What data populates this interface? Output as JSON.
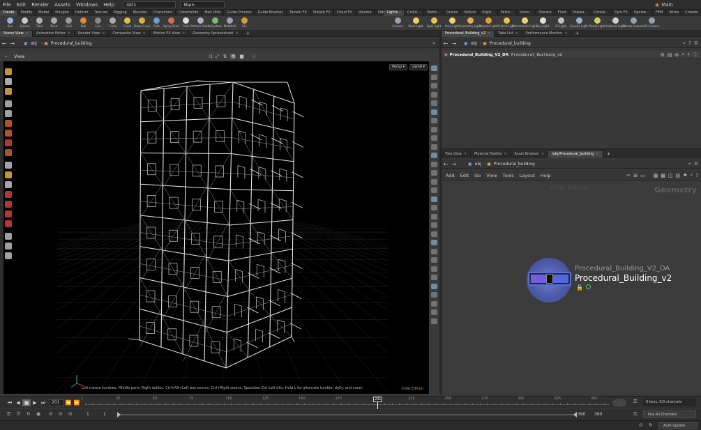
{
  "menubar": {
    "items": [
      "File",
      "Edit",
      "Render",
      "Assets",
      "Windows",
      "Help"
    ],
    "desktop": "GD1",
    "context": "Main",
    "right_label": "Main"
  },
  "shelf_left_tabs": [
    "Create",
    "Modify",
    "Model",
    "Polygon",
    "Deform",
    "Texture",
    "Rigging",
    "Muscles",
    "Characters",
    "Constraints",
    "Hair Utils",
    "Guide Process",
    "Guide Brushes",
    "Terrain FX",
    "Simple FX",
    "Cloud FX",
    "Volume",
    "SideFX Labs"
  ],
  "shelf_right_tabs": [
    "Lights...",
    "Collisi...",
    "Partic...",
    "Grains",
    "Vellum",
    "Rigid...",
    "Partic...",
    "Visco...",
    "Oceans",
    "Fluid",
    "Popula...",
    "Contai...",
    "Pyro FX",
    "Sparse...",
    "FEM",
    "Wires",
    "Crowds",
    "Drive..."
  ],
  "shelf_left_tools": [
    {
      "label": "Box",
      "color": "#8fb3d9"
    },
    {
      "label": "Sphere",
      "color": "#c9c9c9"
    },
    {
      "label": "Tube",
      "color": "#b0b0b0"
    },
    {
      "label": "Torus",
      "color": "#a8a8a8"
    },
    {
      "label": "Grid",
      "color": "#9a9a9a"
    },
    {
      "label": "Null",
      "color": "#e08a2c"
    },
    {
      "label": "Line",
      "color": "#888888"
    },
    {
      "label": "Circle",
      "color": "#aaaaaa"
    },
    {
      "label": "Curve",
      "color": "#e0c040"
    },
    {
      "label": "Draw Curve",
      "color": "#d6b040"
    },
    {
      "label": "Path",
      "color": "#70a0d0"
    },
    {
      "label": "Spray Paint",
      "color": "#d07050"
    },
    {
      "label": "Font",
      "color": "#dddddd"
    },
    {
      "label": "Platonic Solids",
      "color": "#b0b0c0"
    },
    {
      "label": "L-System",
      "color": "#7cb870"
    },
    {
      "label": "Metaball",
      "color": "#a0a0b0"
    },
    {
      "label": "File",
      "color": "#d0a040"
    }
  ],
  "shelf_right_tools": [
    {
      "label": "Camera",
      "color": "#9aa0a8"
    },
    {
      "label": "Point Light",
      "color": "#f0d060"
    },
    {
      "label": "Spot Light",
      "color": "#f0c050"
    },
    {
      "label": "Area Light",
      "color": "#f0d070"
    },
    {
      "label": "Geometry Light",
      "color": "#e0b050"
    },
    {
      "label": "Volume Light",
      "color": "#e09a40"
    },
    {
      "label": "Distant Light",
      "color": "#f0c040"
    },
    {
      "label": "Environment Light",
      "color": "#f0d080"
    },
    {
      "label": "Sky Light",
      "color": "#e0e0e0"
    },
    {
      "label": "GI Light",
      "color": "#c0c0c0"
    },
    {
      "label": "Caustic Light",
      "color": "#9ab0d0"
    },
    {
      "label": "Portal Light",
      "color": "#d0d060"
    },
    {
      "label": "Ambient Light",
      "color": "#d0d0d0"
    },
    {
      "label": "Stereo Camera",
      "color": "#9aa0a8"
    },
    {
      "label": "VR Camera",
      "color": "#9aa0a8"
    }
  ],
  "left_pane_tabs": [
    "Scene View",
    "Animation Editor",
    "Render View",
    "Composite View",
    "Motion FX View",
    "Geometry Spreadsheet"
  ],
  "right_top_tabs": [
    "Procedural_Building_v2",
    "Take List",
    "Performance Monitor"
  ],
  "left_path": {
    "obj": "obj",
    "node": "Procedural_building"
  },
  "viewport": {
    "title": "View",
    "persp": "Persp",
    "cam": "cam4",
    "hint": "Left mouse tumbles. Middle pans. Right dollies. Ctrl+Alt+Left box-zooms. Ctrl+Right zooms. Spacebar-Ctrl-Left tilts. Hold L for alternate tumble, dolly, and zoom.",
    "edition": "Indie Edition"
  },
  "param_path": {
    "obj": "obj",
    "node": "Procedural_building"
  },
  "param_header": {
    "type_name": "Procedural_Building_V2_DA",
    "node_name": "Procedural_Building_v2"
  },
  "bottom_tabs": [
    "Tree View",
    "Material Palette",
    "Asset Browser",
    "/obj/Procedural_building"
  ],
  "net_path": {
    "obj": "obj",
    "node": "Procedural_building"
  },
  "net_menu": [
    "Add",
    "Edit",
    "Go",
    "View",
    "Tools",
    "Layout",
    "Help"
  ],
  "net_editor": {
    "watermark": "Indie Edition",
    "context_label": "Geometry",
    "node_type": "Procedural_Building_V2_DA",
    "node_name": "Procedural_Building_v2"
  },
  "timeline": {
    "current_frame": "201",
    "ticks": [
      "1",
      "25",
      "50",
      "75",
      "100",
      "125",
      "150",
      "175",
      "201",
      "225",
      "250",
      "275",
      "300",
      "325",
      "350"
    ],
    "tick_values": [
      1,
      25,
      50,
      75,
      100,
      125,
      150,
      175,
      201,
      225,
      250,
      275,
      300,
      325,
      350
    ],
    "range_start": 1,
    "range_end": 360,
    "keys_info": "0 keys, 0/0 channels",
    "key_all": "Key All Channels"
  },
  "range": {
    "start1": "1",
    "start2": "1",
    "end1": "360",
    "end2": "360"
  },
  "status": {
    "auto_update": "Auto Update"
  }
}
